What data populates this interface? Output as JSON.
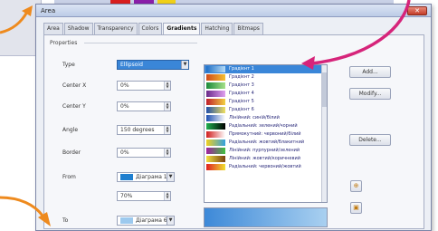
{
  "dialog": {
    "title": "Area",
    "close_glyph": "✕",
    "tabs": [
      "Area",
      "Shadow",
      "Transparency",
      "Colors",
      "Gradients",
      "Hatching",
      "Bitmaps"
    ],
    "active_tab": "Gradients"
  },
  "properties": {
    "group_label": "Properties",
    "type": {
      "label": "Type",
      "value": "Ellipsoid"
    },
    "center_x": {
      "label": "Center X",
      "value": "0%"
    },
    "center_y": {
      "label": "Center Y",
      "value": "0%"
    },
    "angle": {
      "label": "Angle",
      "value": "150 degrees"
    },
    "border": {
      "label": "Border",
      "value": "0%"
    },
    "from": {
      "label": "From",
      "color_name": "Діаграма 1",
      "color": "#1f7fcf",
      "intensity": "70%"
    },
    "to": {
      "label": "To",
      "color_name": "Діаграма 6",
      "color": "#9cc9ee"
    }
  },
  "gradient_list": {
    "items": [
      {
        "label": "Градієнт 1",
        "c1": "#1f6fc6",
        "c2": "#b7dcf6"
      },
      {
        "label": "Градієнт 2",
        "c1": "#d04a1a",
        "c2": "#f5c030"
      },
      {
        "label": "Градієнт 3",
        "c1": "#1a8a3a",
        "c2": "#a6e08a"
      },
      {
        "label": "Градієнт 4",
        "c1": "#6a2a8a",
        "c2": "#e0a0f0"
      },
      {
        "label": "Градієнт 5",
        "c1": "#c01e2a",
        "c2": "#f2d040"
      },
      {
        "label": "Градієнт 6",
        "c1": "#204fa8",
        "c2": "#f0e060"
      },
      {
        "label": "Лінійний: синій/білий",
        "c1": "#1e4fb0",
        "c2": "#ffffff"
      },
      {
        "label": "Радіальний: зелений/чорний",
        "c1": "#20b050",
        "c2": "#000000"
      },
      {
        "label": "Прямокутний: червоний/білий",
        "c1": "#d01e1e",
        "c2": "#ffffff"
      },
      {
        "label": "Радіальний: жовтий/блакитний",
        "c1": "#f0d020",
        "c2": "#30a0e0"
      },
      {
        "label": "Лінійний: пурпурний/зелений",
        "c1": "#a020a0",
        "c2": "#40c040"
      },
      {
        "label": "Лінійний: жовтий/коричневий",
        "c1": "#f0e040",
        "c2": "#7a4010"
      },
      {
        "label": "Радіальний: червоний/жовтий",
        "c1": "#e02020",
        "c2": "#f0e030"
      }
    ],
    "selected_index": 0
  },
  "buttons": {
    "add": "Add...",
    "modify": "Modify...",
    "delete": "Delete..."
  },
  "preview": {
    "c1": "#3d89d8",
    "c2": "#a9d0f0"
  },
  "accents": {
    "arrow_magenta": "#d6247a",
    "arrow_orange": "#ee8a1e"
  }
}
